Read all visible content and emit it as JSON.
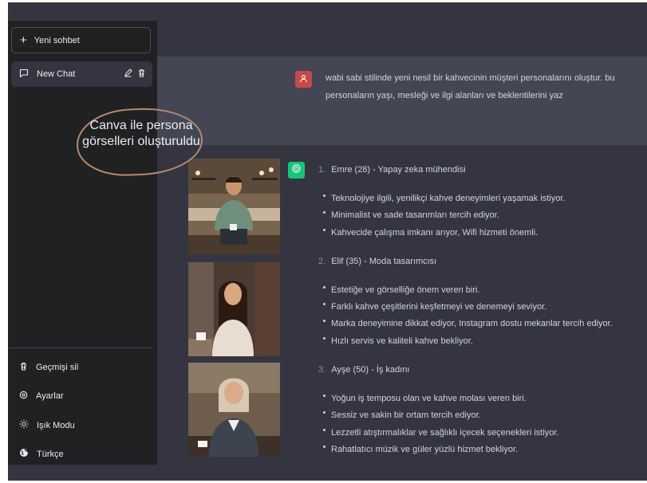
{
  "sidebar": {
    "new_chat_label": "Yeni sohbet",
    "chat_items": [
      {
        "label": "New Chat"
      }
    ],
    "menu": [
      {
        "label": "Geçmişi sil",
        "icon": "trash-icon"
      },
      {
        "label": "Ayarlar",
        "icon": "gear-icon"
      },
      {
        "label": "Işık Modu",
        "icon": "sun-icon"
      },
      {
        "label": "Türkçe",
        "icon": "globe-icon"
      }
    ]
  },
  "annotation": {
    "text": "Canva ile persona görselleri oluşturuldu"
  },
  "conversation": {
    "user_message": "wabi sabi stilinde yeni nesil bir kahvecinin müşteri personalarını oluştur. bu personaların yaşı, mesleği ve ilgi alanları ve beklentilerini yaz",
    "personas": [
      {
        "number": "1.",
        "title": "Emre (28) - Yapay zeka mühendisi",
        "bullets": [
          "Teknolojiye ilgili, yenilikçi kahve deneyimleri yaşamak istiyor.",
          "Minimalist ve sade tasarımları tercih ediyor.",
          "Kahvecide çalışma imkanı arıyor, Wifi hizmeti önemli."
        ]
      },
      {
        "number": "2.",
        "title": "Elif (35) - Moda tasarımcısı",
        "bullets": [
          "Estetiğe ve görselliğe önem veren biri.",
          "Farklı kahve çeşitlerini keşfetmeyi ve denemeyi seviyor.",
          "Marka deneyimine dikkat ediyor, Instagram dostu mekanlar tercih ediyor.",
          "Hızlı servis ve kaliteli kahve bekliyor."
        ]
      },
      {
        "number": "3.",
        "title": "Ayşe (50) - İş kadını",
        "bullets": [
          "Yoğun iş temposu olan ve kahve molası veren biri.",
          "Sessiz ve sakin bir ortam tercih ediyor.",
          "Lezzetli atıştırmalıklar ve sağlıklı içecek seçenekleri istiyor.",
          "Rahatlatıcı müzik ve güler yüzlü hizmet bekliyor."
        ]
      }
    ]
  },
  "colors": {
    "sidebar_bg": "#202123",
    "main_bg": "#343541",
    "user_row_bg": "#444654",
    "user_avatar": "#c34b4b",
    "bot_avatar": "#19c37d",
    "annotation_outline": "#b88a6a"
  }
}
